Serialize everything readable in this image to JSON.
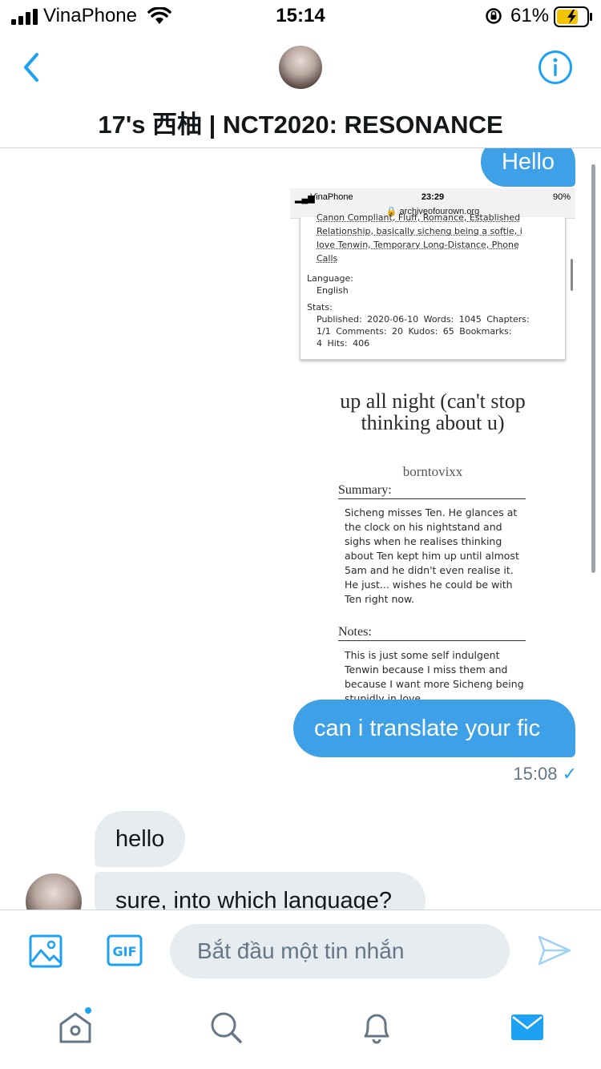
{
  "status_bar": {
    "carrier": "VinaPhone",
    "time": "15:14",
    "battery_percent": "61%"
  },
  "header": {
    "title": "17's 西柚 | NCT2020: RESONANCE"
  },
  "messages": {
    "sent_hello": "Hello",
    "sent_translate": "can i translate your fic",
    "sent_timestamp": "15:08",
    "received_hello": "hello",
    "received_sure": "sure, into which language?"
  },
  "attached_screenshot": {
    "status_carrier": "VinaPhone",
    "status_time": "23:29",
    "status_battery": "90%",
    "url": "archiveofourown.org",
    "tags_line1": "Canon Compliant,  Fluff,  Romance,  Established",
    "tags_line2": "Relationship,  basically sicheng being a softie,  i",
    "tags_line3": "love Tenwin,  Temporary Long-Distance,  Phone",
    "tags_line4": "Calls",
    "language_label": "Language:",
    "language_value": "English",
    "stats_label": "Stats:",
    "stats_line1": "Published: 2020-06-10  Words: 1045  Chapters:",
    "stats_line2": "1/1  Comments: 20  Kudos: 65  Bookmarks:",
    "stats_line3": "4  Hits: 406",
    "work_title": "up all night (can't stop thinking about u)",
    "author": "borntovixx",
    "summary_label": "Summary:",
    "summary_text": "Sicheng misses Ten. He glances at the clock on his nightstand and sighs when he realises thinking about Ten kept him up until almost 5am and he didn't even realise it. He just... wishes he could be with Ten right now.",
    "notes_label": "Notes:",
    "notes_text": "This is just some self indulgent Tenwin because I miss them and because I want more Sicheng being stupidly in love"
  },
  "composer": {
    "placeholder": "Bắt đầu một tin nhắn"
  },
  "icons": {
    "accent": "#1da1f2",
    "back": "chevron-left-icon",
    "info": "info-icon",
    "image": "image-icon",
    "gif": "gif-icon",
    "send": "send-icon",
    "home": "home-icon",
    "search": "search-icon",
    "notifications": "bell-icon",
    "messages": "envelope-icon"
  }
}
